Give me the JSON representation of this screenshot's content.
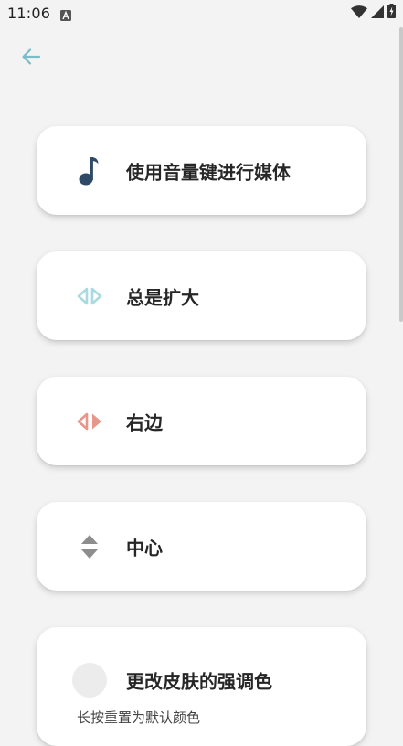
{
  "status_bar": {
    "time": "11:06",
    "notification_icon": "a-letter-icon",
    "wifi_icon": "wifi-icon",
    "signal_icon": "signal-icon",
    "battery_icon": "battery-charging-icon"
  },
  "header": {
    "back_icon": "arrow-left-icon",
    "back_color": "#7bbcc9"
  },
  "settings": [
    {
      "label": "使用音量键进行媒体",
      "icon": "music-note-icon",
      "icon_color": "#2e4a66"
    },
    {
      "label": "总是扩大",
      "icon": "expand-arrows-icon",
      "icon_color": "#a9dadf"
    },
    {
      "label": "右边",
      "icon": "right-arrows-icon",
      "icon_color": "#e8958a"
    },
    {
      "label": "中心",
      "icon": "center-arrows-icon",
      "icon_color": "#8d8d8d"
    },
    {
      "label": "更改皮肤的强调色",
      "sublabel": "长按重置为默认颜色",
      "icon": "color-circle-icon",
      "icon_color": "#ececec"
    }
  ]
}
